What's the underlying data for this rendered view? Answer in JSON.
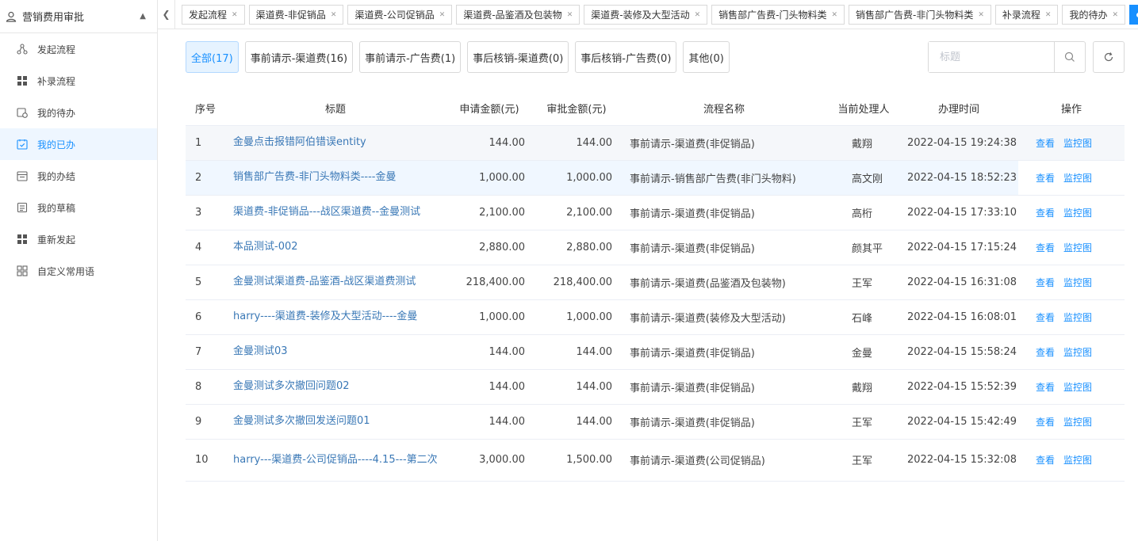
{
  "sidebar": {
    "title": "营销费用审批",
    "items": [
      {
        "label": "发起流程",
        "icon": "flow-icon"
      },
      {
        "label": "补录流程",
        "icon": "grid-icon"
      },
      {
        "label": "我的待办",
        "icon": "todo-icon"
      },
      {
        "label": "我的已办",
        "icon": "calendar-check-icon",
        "active": true
      },
      {
        "label": "我的办结",
        "icon": "calendar-icon"
      },
      {
        "label": "我的草稿",
        "icon": "draft-icon"
      },
      {
        "label": "重新发起",
        "icon": "grid-icon"
      },
      {
        "label": "自定义常用语",
        "icon": "apps-icon"
      }
    ]
  },
  "tabs": [
    {
      "label": "发起流程"
    },
    {
      "label": "渠道费-非促销品"
    },
    {
      "label": "渠道费-公司促销品"
    },
    {
      "label": "渠道费-品鉴酒及包装物"
    },
    {
      "label": "渠道费-装修及大型活动"
    },
    {
      "label": "销售部广告费-门头物料类"
    },
    {
      "label": "销售部广告费-非门头物料类"
    },
    {
      "label": "补录流程"
    },
    {
      "label": "我的待办"
    },
    {
      "label": "我的已办",
      "active": true
    }
  ],
  "filters": [
    {
      "label": "全部(17)",
      "active": true
    },
    {
      "label": "事前请示-渠道费(16)"
    },
    {
      "label": "事前请示-广告费(1)"
    },
    {
      "label": "事后核销-渠道费(0)"
    },
    {
      "label": "事后核销-广告费(0)"
    },
    {
      "label": "其他(0)"
    }
  ],
  "search": {
    "placeholder": "标题"
  },
  "table": {
    "headers": [
      "序号",
      "标题",
      "申请金额(元)",
      "审批金额(元)",
      "流程名称",
      "当前处理人",
      "办理时间",
      "操作"
    ],
    "actions": {
      "view": "查看",
      "monitor": "监控图"
    },
    "rows": [
      {
        "no": "1",
        "title": "金曼点击报错阿伯错误entity",
        "apply": "144.00",
        "approve": "144.00",
        "flow": "事前请示-渠道费(非促销品)",
        "person": "戴翔",
        "time": "2022-04-15 19:24:38"
      },
      {
        "no": "2",
        "title": "销售部广告费-非门头物料类----金曼",
        "apply": "1,000.00",
        "approve": "1,000.00",
        "flow": "事前请示-销售部广告费(非门头物料)",
        "person": "高文刚",
        "time": "2022-04-15 18:52:23"
      },
      {
        "no": "3",
        "title": "渠道费-非促销品---战区渠道费--金曼测试",
        "apply": "2,100.00",
        "approve": "2,100.00",
        "flow": "事前请示-渠道费(非促销品)",
        "person": "高桁",
        "time": "2022-04-15 17:33:10"
      },
      {
        "no": "4",
        "title": "本品测试-002",
        "apply": "2,880.00",
        "approve": "2,880.00",
        "flow": "事前请示-渠道费(非促销品)",
        "person": "颜其平",
        "time": "2022-04-15 17:15:24"
      },
      {
        "no": "5",
        "title": "金曼测试渠道费-品鉴酒-战区渠道费测试",
        "apply": "218,400.00",
        "approve": "218,400.00",
        "flow": "事前请示-渠道费(品鉴酒及包装物)",
        "person": "王军",
        "time": "2022-04-15 16:31:08"
      },
      {
        "no": "6",
        "title": "harry----渠道费-装修及大型活动----金曼",
        "apply": "1,000.00",
        "approve": "1,000.00",
        "flow": "事前请示-渠道费(装修及大型活动)",
        "person": "石峰",
        "time": "2022-04-15 16:08:01"
      },
      {
        "no": "7",
        "title": "金曼测试03",
        "apply": "144.00",
        "approve": "144.00",
        "flow": "事前请示-渠道费(非促销品)",
        "person": "金曼",
        "time": "2022-04-15 15:58:24"
      },
      {
        "no": "8",
        "title": "金曼测试多次撤回问题02",
        "apply": "144.00",
        "approve": "144.00",
        "flow": "事前请示-渠道费(非促销品)",
        "person": "戴翔",
        "time": "2022-04-15 15:52:39"
      },
      {
        "no": "9",
        "title": "金曼测试多次撤回发送问题01",
        "apply": "144.00",
        "approve": "144.00",
        "flow": "事前请示-渠道费(非促销品)",
        "person": "王军",
        "time": "2022-04-15 15:42:49"
      },
      {
        "no": "10",
        "title": "harry---渠道费-公司促销品----4.15---第二次",
        "apply": "3,000.00",
        "approve": "1,500.00",
        "flow": "事前请示-渠道费(公司促销品)",
        "person": "王军",
        "time": "2022-04-15 15:32:08"
      }
    ]
  },
  "colors": {
    "accent": "#1890ff",
    "link": "#3a78b6",
    "border": "#e6e6e6"
  }
}
